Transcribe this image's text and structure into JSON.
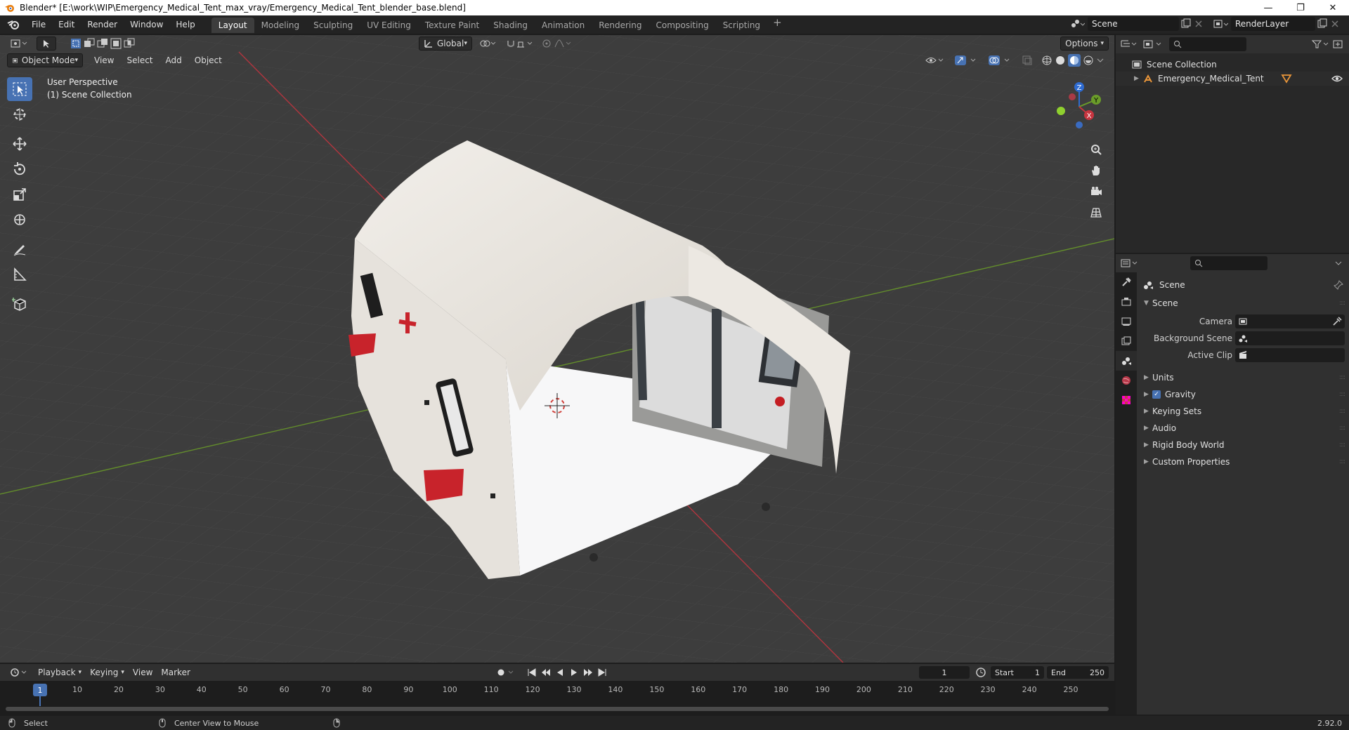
{
  "window": {
    "title": "Blender* [E:\\work\\WIP\\Emergency_Medical_Tent_max_vray/Emergency_Medical_Tent_blender_base.blend]",
    "min_glyph": "—",
    "max_glyph": "❐",
    "close_glyph": "✕"
  },
  "topbar": {
    "menus": [
      "File",
      "Edit",
      "Render",
      "Window",
      "Help"
    ],
    "workspaces": [
      "Layout",
      "Modeling",
      "Sculpting",
      "UV Editing",
      "Texture Paint",
      "Shading",
      "Animation",
      "Rendering",
      "Compositing",
      "Scripting"
    ],
    "active_workspace": "Layout",
    "add_glyph": "+",
    "scene": "Scene",
    "view_layer": "RenderLayer"
  },
  "viewport": {
    "mode": "Object Mode",
    "menus": [
      "View",
      "Select",
      "Add",
      "Object"
    ],
    "transform_orientation": "Global",
    "options_label": "Options",
    "overlay_line1": "User Perspective",
    "overlay_line2": "(1) Scene Collection",
    "gizmo_axes": {
      "x": "X",
      "y": "Y",
      "z": "Z"
    },
    "colors": {
      "x_axis": "#c7343f",
      "y_axis": "#6a9c29",
      "z_axis": "#2e6bd1",
      "accent": "#4772b3"
    }
  },
  "outliner": {
    "root": "Scene Collection",
    "items": [
      {
        "label": "Emergency_Medical_Tent"
      }
    ]
  },
  "properties": {
    "context": "Scene",
    "panel_title": "Scene",
    "fields": [
      {
        "label": "Camera",
        "value": ""
      },
      {
        "label": "Background Scene",
        "value": ""
      },
      {
        "label": "Active Clip",
        "value": ""
      }
    ],
    "subpanels": [
      "Units",
      "Gravity",
      "Keying Sets",
      "Audio",
      "Rigid Body World",
      "Custom Properties"
    ],
    "gravity_enabled": true
  },
  "timeline": {
    "menus": [
      "Playback",
      "Keying",
      "View",
      "Marker"
    ],
    "current_frame": "1",
    "start_label": "Start",
    "start": "1",
    "end_label": "End",
    "end": "250",
    "ruler": [
      "1",
      "10",
      "20",
      "30",
      "40",
      "50",
      "60",
      "70",
      "80",
      "90",
      "100",
      "110",
      "120",
      "130",
      "140",
      "150",
      "160",
      "170",
      "180",
      "190",
      "200",
      "210",
      "220",
      "230",
      "240",
      "250"
    ]
  },
  "statusbar": {
    "left_action": "Select",
    "middle_action": "Center View to Mouse",
    "version": "2.92.0"
  }
}
